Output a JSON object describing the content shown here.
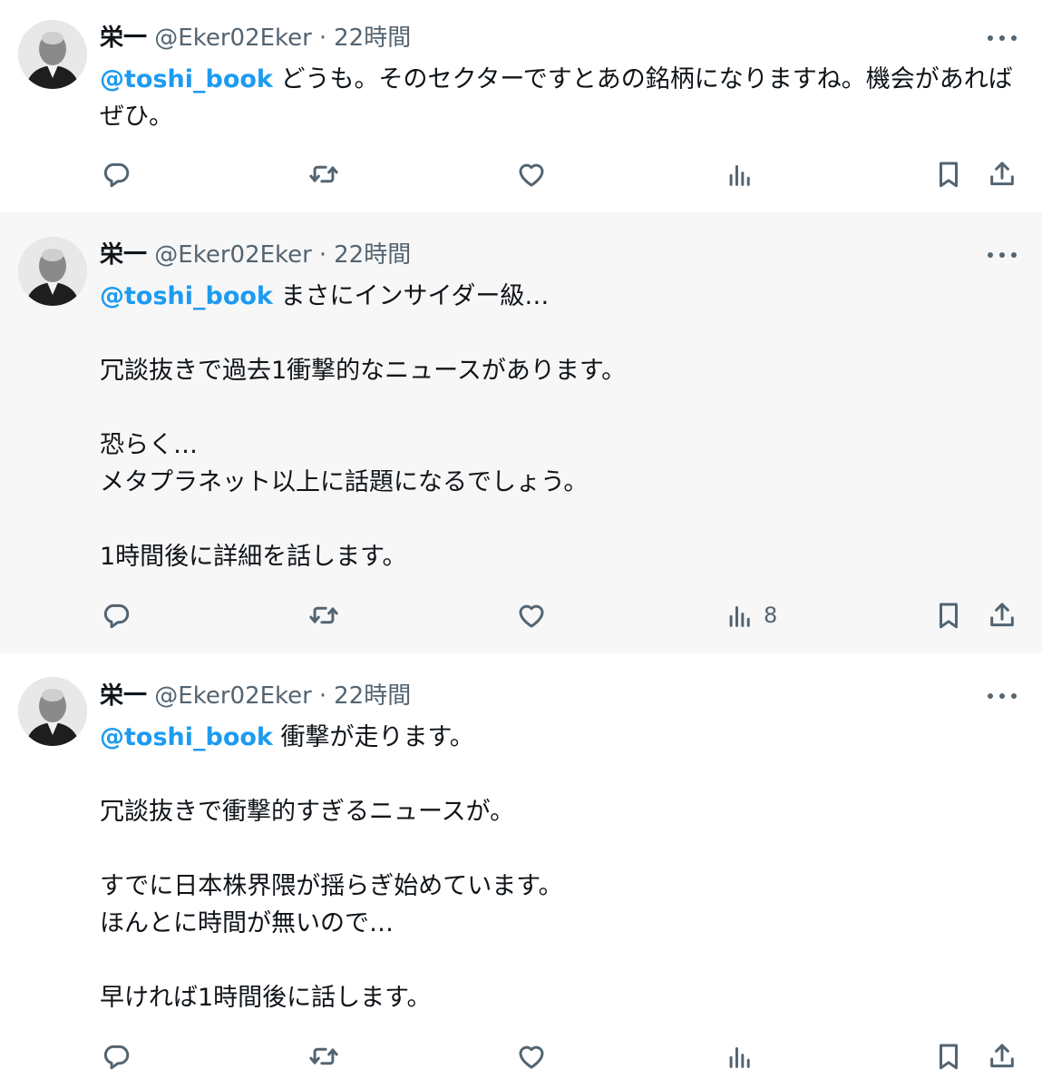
{
  "tweets": [
    {
      "author": {
        "name": "栄一",
        "handle": "@Eker02Eker",
        "separator": "·",
        "time": "22時間"
      },
      "mention": "@toshi_book",
      "lines": [
        "どうも。そのセクターですとあの銘柄になりますね。機会があれば",
        "ぜひ。"
      ],
      "views": ""
    },
    {
      "author": {
        "name": "栄一",
        "handle": "@Eker02Eker",
        "separator": "·",
        "time": "22時間"
      },
      "mention": "@toshi_book",
      "lines": [
        "まさにインサイダー級…",
        "",
        "冗談抜きで過去1衝撃的なニュースがあります。",
        "",
        "恐らく…",
        "メタプラネット以上に話題になるでしょう。",
        "",
        "1時間後に詳細を話します。"
      ],
      "views": "8"
    },
    {
      "author": {
        "name": "栄一",
        "handle": "@Eker02Eker",
        "separator": "·",
        "time": "22時間"
      },
      "mention": "@toshi_book",
      "lines": [
        "衝撃が走ります。",
        "",
        "冗談抜きで衝撃的すぎるニュースが。",
        "",
        "すでに日本株界隈が揺らぎ始めています。",
        "ほんとに時間が無いので…",
        "",
        "早ければ1時間後に話します。"
      ],
      "views": ""
    }
  ],
  "icons": {
    "reply": "reply-icon",
    "retweet": "retweet-icon",
    "like": "heart-icon",
    "views": "views-icon",
    "bookmark": "bookmark-icon",
    "share": "share-icon",
    "more": "more-icon"
  },
  "colors": {
    "mention": "#1d9bf0",
    "secondary_text": "#536471",
    "highlight_bg": "#f7f7f7"
  }
}
